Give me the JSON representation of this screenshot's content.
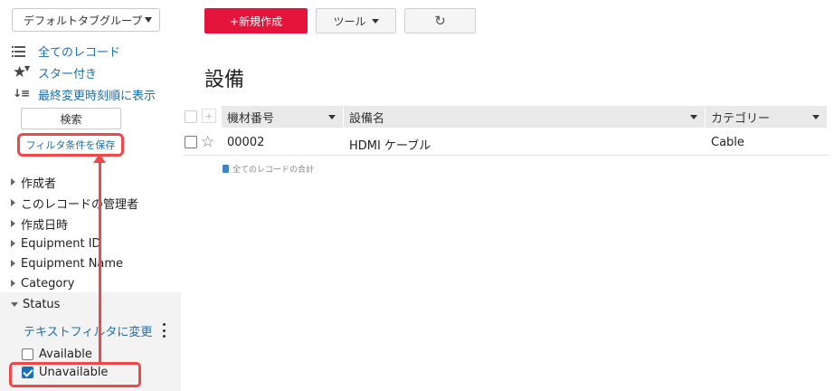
{
  "sidebar": {
    "group_select": "デフォルトタブグループ",
    "nav": {
      "all_records": "全てのレコード",
      "starred": "スター付き",
      "recent": "最終変更時刻順に表示"
    },
    "sort_icon_text": "↓≡",
    "search_label": "検索",
    "save_filter_label": "フィルタ条件を保存",
    "fields": [
      "作成者",
      "このレコードの管理者",
      "作成日時",
      "Equipment ID",
      "Equipment Name",
      "Category"
    ],
    "status_field": "Status",
    "text_filter_label": "テキストフィルタに変更",
    "status_options": [
      {
        "label": "Available",
        "checked": false
      },
      {
        "label": "Unavailable",
        "checked": true
      }
    ]
  },
  "toolbar": {
    "new_label": "+新規作成",
    "tools_label": "ツール",
    "refresh_icon": "↻"
  },
  "main": {
    "title": "設備",
    "columns": [
      "機材番号",
      "設備名",
      "カテゴリー"
    ],
    "head_plus": "+",
    "rows": [
      {
        "star": "☆",
        "cells": [
          "00002",
          "HDMI ケーブル",
          "Cable"
        ]
      }
    ],
    "summary": "全てのレコードの合計"
  },
  "colors": {
    "accent_red": "#e4143c",
    "link_blue": "#1a6fb5",
    "annotation_red": "#f04848"
  }
}
